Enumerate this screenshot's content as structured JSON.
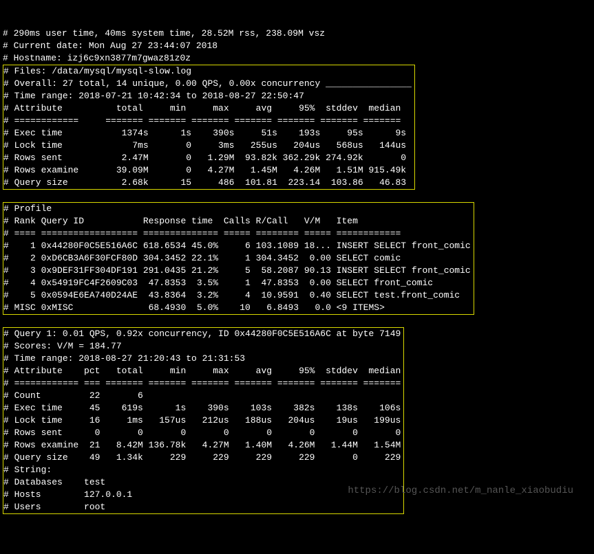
{
  "header": {
    "l1": "# 290ms user time, 40ms system time, 28.52M rss, 238.09M vsz",
    "l2": "# Current date: Mon Aug 27 23:44:07 2018",
    "l3": "# Hostname: izj6c9xn3877m7gwaz81z0z"
  },
  "box1": {
    "files": "# Files: /data/mysql/mysql-slow.log",
    "overall": "# Overall: 27 total, 14 unique, 0.00 QPS, 0.00x concurrency ________________",
    "timerange": "# Time range: 2018-07-21 10:42:34 to 2018-08-27 22:50:47",
    "hdr": "# Attribute          total     min     max     avg     95%  stddev  median",
    "sep": "# ============     ======= ======= ======= ======= ======= ======= =======",
    "r1": "# Exec time           1374s      1s    390s     51s    193s     95s      9s",
    "r2": "# Lock time             7ms       0     3ms   255us   204us   568us   144us",
    "r3": "# Rows sent           2.47M       0   1.29M  93.82k 362.29k 274.92k       0",
    "r4": "# Rows examine       39.09M       0   4.27M   1.45M   4.26M   1.51M 915.49k",
    "r5": "# Query size          2.68k      15     486  101.81  223.14  103.86   46.83"
  },
  "box2": {
    "title": "# Profile",
    "hdr": "# Rank Query ID           Response time  Calls R/Call   V/M   Item",
    "sep": "# ==== ================== ============== ===== ======== ===== ============",
    "r1": "#    1 0x44280F0C5E516A6C 618.6534 45.0%     6 103.1089 18... INSERT SELECT front_comic",
    "r2": "#    2 0xD6CB3A6F30FCF80D 304.3452 22.1%     1 304.3452  0.00 SELECT comic",
    "r3": "#    3 0x9DEF31FF304DF191 291.0435 21.2%     5  58.2087 90.13 INSERT SELECT front_comic",
    "r4": "#    4 0x54919FC4F2609C03  47.8353  3.5%     1  47.8353  0.00 SELECT front_comic",
    "r5": "#    5 0x0594E6EA740D24AE  43.8364  3.2%     4  10.9591  0.40 SELECT test.front_comic",
    "r6": "# MISC 0xMISC              68.4930  5.0%    10   6.8493   0.0 <9 ITEMS>"
  },
  "box3": {
    "l1": "# Query 1: 0.01 QPS, 0.92x concurrency, ID 0x44280F0C5E516A6C at byte 7149",
    "l2": "# Scores: V/M = 184.77",
    "l3": "# Time range: 2018-08-27 21:20:43 to 21:31:53",
    "hdr": "# Attribute    pct   total     min     max     avg     95%  stddev  median",
    "sep": "# ============ === ======= ======= ======= ======= ======= ======= =======",
    "r1": "# Count         22       6",
    "r2": "# Exec time     45    619s      1s    390s    103s    382s    138s    106s",
    "r3": "# Lock time     16     1ms   157us   212us   188us   204us    19us   199us",
    "r4": "# Rows sent      0       0       0       0       0       0       0       0",
    "r5": "# Rows examine  21   8.42M 136.78k   4.27M   1.40M   4.26M   1.44M   1.54M",
    "r6": "# Query size    49   1.34k     229     229     229     229       0     229",
    "r7": "# String:",
    "r8": "# Databases    test",
    "r9": "# Hosts        127.0.0.1",
    "r10": "# Users        root"
  },
  "watermark": "https://blog.csdn.net/m_nanle_xiaobudiu"
}
